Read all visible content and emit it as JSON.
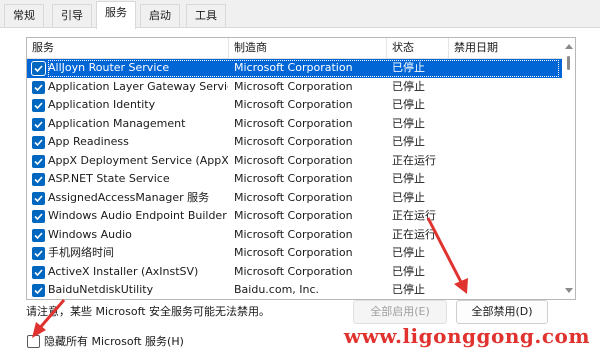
{
  "tabs": [
    {
      "label": "常规"
    },
    {
      "label": "引导"
    },
    {
      "label": "服务"
    },
    {
      "label": "启动"
    },
    {
      "label": "工具"
    }
  ],
  "active_tab": "服务",
  "columns": {
    "service": "服务",
    "manufacturer": "制造商",
    "status": "状态",
    "disabled_date": "禁用日期"
  },
  "services": [
    {
      "name": "AllJoyn Router Service",
      "manufacturer": "Microsoft Corporation",
      "status": "已停止",
      "checked": true,
      "selected": true
    },
    {
      "name": "Application Layer Gateway Service",
      "manufacturer": "Microsoft Corporation",
      "status": "已停止",
      "checked": true
    },
    {
      "name": "Application Identity",
      "manufacturer": "Microsoft Corporation",
      "status": "已停止",
      "checked": true
    },
    {
      "name": "Application Management",
      "manufacturer": "Microsoft Corporation",
      "status": "已停止",
      "checked": true
    },
    {
      "name": "App Readiness",
      "manufacturer": "Microsoft Corporation",
      "status": "已停止",
      "checked": true
    },
    {
      "name": "AppX Deployment Service (AppX...",
      "manufacturer": "Microsoft Corporation",
      "status": "正在运行",
      "checked": true
    },
    {
      "name": "ASP.NET State Service",
      "manufacturer": "Microsoft Corporation",
      "status": "已停止",
      "checked": true
    },
    {
      "name": "AssignedAccessManager 服务",
      "manufacturer": "Microsoft Corporation",
      "status": "已停止",
      "checked": true
    },
    {
      "name": "Windows Audio Endpoint Builder",
      "manufacturer": "Microsoft Corporation",
      "status": "正在运行",
      "checked": true
    },
    {
      "name": "Windows Audio",
      "manufacturer": "Microsoft Corporation",
      "status": "正在运行",
      "checked": true
    },
    {
      "name": "手机网络时间",
      "manufacturer": "Microsoft Corporation",
      "status": "已停止",
      "checked": true
    },
    {
      "name": "ActiveX Installer (AxInstSV)",
      "manufacturer": "Microsoft Corporation",
      "status": "已停止",
      "checked": true
    },
    {
      "name": "BaiduNetdiskUtility",
      "manufacturer": "Baidu.com, Inc.",
      "status": "已停止",
      "checked": true
    }
  ],
  "note": "请注意，某些 Microsoft 安全服务可能无法禁用。",
  "buttons": {
    "enable_all": "全部启用(E)",
    "disable_all": "全部禁用(D)"
  },
  "hide_ms": {
    "label": "隐藏所有 Microsoft 服务(H)",
    "checked": false
  },
  "watermark": "www.ligonggong.com",
  "colors": {
    "selection": "#0066d6",
    "checkbox": "#0067c0",
    "annotation_arrow": "#e0322e"
  }
}
